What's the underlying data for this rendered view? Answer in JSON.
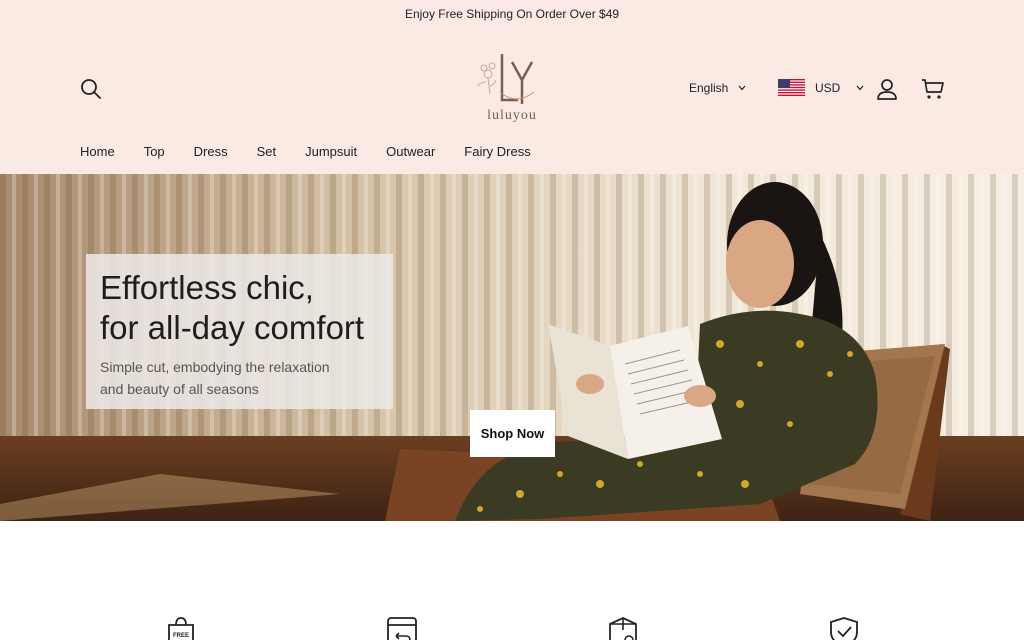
{
  "announcement": "Enjoy Free Shipping On Order Over $49",
  "brand": {
    "name": "luluyou",
    "monogram": "LY"
  },
  "header": {
    "language": "English",
    "currency": "USD"
  },
  "nav": {
    "items": [
      "Home",
      "Top",
      "Dress",
      "Set",
      "Jumpsuit",
      "Outwear",
      "Fairy Dress"
    ]
  },
  "hero": {
    "title_line1": "Effortless chic,",
    "title_line2": "for all-day comfort",
    "subtitle_line1": "Simple cut, embodying the relaxation",
    "subtitle_line2": "and beauty of all seasons",
    "cta": "Shop Now"
  },
  "features": {
    "icons": [
      "free-shipping-bag-icon",
      "returns-icon",
      "package-icon",
      "shield-check-icon"
    ],
    "free_badge": "FREE"
  },
  "colors": {
    "header_bg": "#fbeae4",
    "text": "#222222",
    "logo": "#7a5e4f"
  }
}
